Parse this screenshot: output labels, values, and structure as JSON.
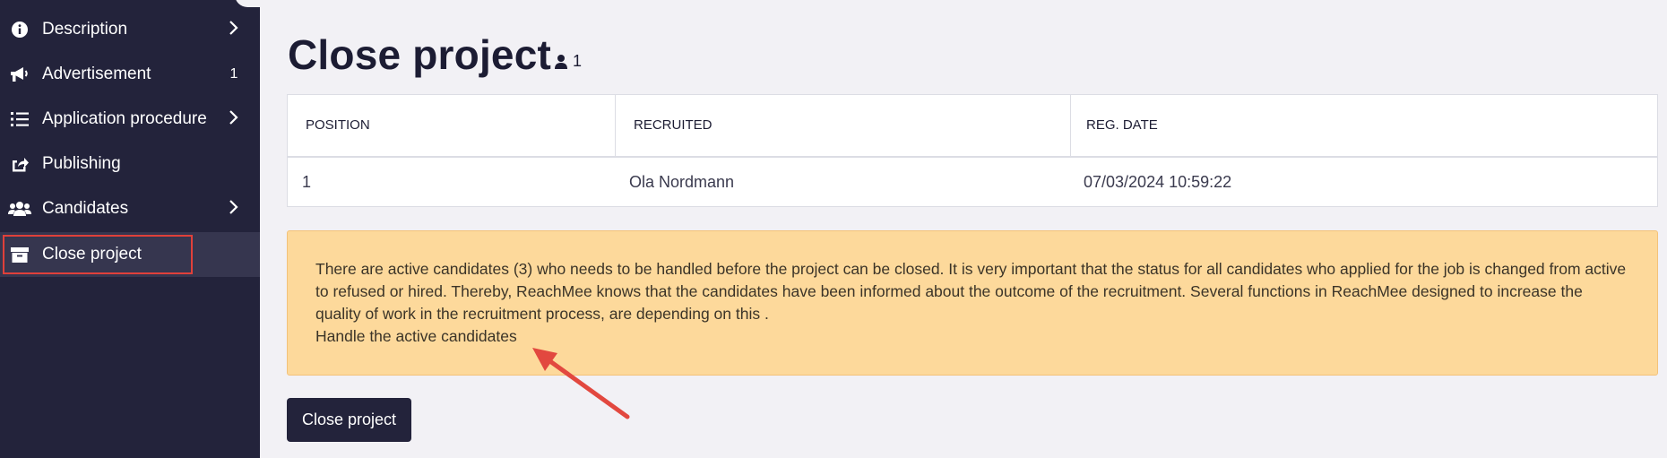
{
  "sidebar": {
    "items": [
      {
        "label": "Description",
        "icon": "info-circle-icon",
        "right": "chevron"
      },
      {
        "label": "Advertisement",
        "icon": "megaphone-icon",
        "badge": "1"
      },
      {
        "label": "Application procedure",
        "icon": "numbered-list-icon",
        "right": "chevron"
      },
      {
        "label": "Publishing",
        "icon": "share-icon"
      },
      {
        "label": "Candidates",
        "icon": "users-icon",
        "right": "chevron"
      },
      {
        "label": "Close project",
        "icon": "archive-box-icon",
        "active": true
      }
    ]
  },
  "main": {
    "title": "Close project",
    "user_count": "1",
    "table": {
      "headers": [
        "POSITION",
        "RECRUITED",
        "REG. DATE"
      ],
      "rows": [
        {
          "position": "1",
          "recruited": "Ola Nordmann",
          "reg_date": "07/03/2024 10:59:22"
        }
      ]
    },
    "warning": {
      "text": "There are active candidates (3) who needs to be handled before the project can be closed. It is very important that the status for all candidates who applied for the job is changed from active to refused or hired. Thereby, ReachMee knows that the candidates have been informed about the outcome of the recruitment. Several functions in ReachMee designed to increase the quality of work in the recruitment process, are depending on this .",
      "link": "Handle the active candidates"
    },
    "close_button": "Close project"
  },
  "colors": {
    "sidebar_bg": "#23233b",
    "active_item_bg": "#36364f",
    "highlight_border": "#e0403a",
    "warning_bg": "#fdd99b",
    "arrow": "#e2483f",
    "button_bg": "#23233b",
    "page_bg": "#f2f1f5"
  }
}
